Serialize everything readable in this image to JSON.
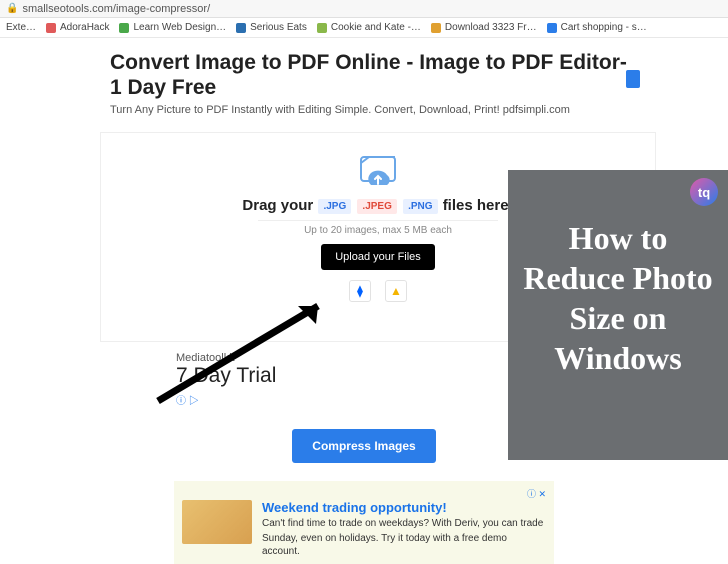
{
  "urlbar": {
    "url": "smallseotools.com/image-compressor/"
  },
  "bookmarks": [
    {
      "label": "Exte…",
      "color": "#888"
    },
    {
      "label": "AdoraHack",
      "color": "#e05a5a"
    },
    {
      "label": "Learn Web Design…",
      "color": "#4aa84a"
    },
    {
      "label": "Serious Eats",
      "color": "#2b6fb0"
    },
    {
      "label": "Cookie and Kate -…",
      "color": "#8ab84a"
    },
    {
      "label": "Download 3323 Fr…",
      "color": "#e0a030"
    },
    {
      "label": "Cart shopping - s…",
      "color": "#2b7de9"
    }
  ],
  "ad_hero": {
    "title": "Convert Image to PDF Online - Image to PDF Editor-1 Day Free",
    "desc": "Turn Any Picture to PDF Instantly with Editing Simple. Convert, Download, Print! pdfsimpli.com"
  },
  "tool": {
    "drag_prefix": "Drag your",
    "chips": {
      "jpg": ".JPG",
      "jpeg": ".JPEG",
      "png": ".PNG"
    },
    "drag_suffix": "files here!",
    "limit": "Up to 20 images, max 5 MB each",
    "upload_label": "Upload your Files"
  },
  "ad2": {
    "brand": "Mediatoolkit",
    "headline": "7 Day Trial"
  },
  "compress_label": "Compress Images",
  "ad3": {
    "title": "Weekend trading opportunity!",
    "line1": "Can't find time to trade on weekdays? With Deriv, you can trade",
    "line2": "Sunday, even on holidays. Try it today with a free demo account."
  },
  "overlay": {
    "logo": "tq",
    "title": "How to Reduce Photo Size on Windows"
  }
}
